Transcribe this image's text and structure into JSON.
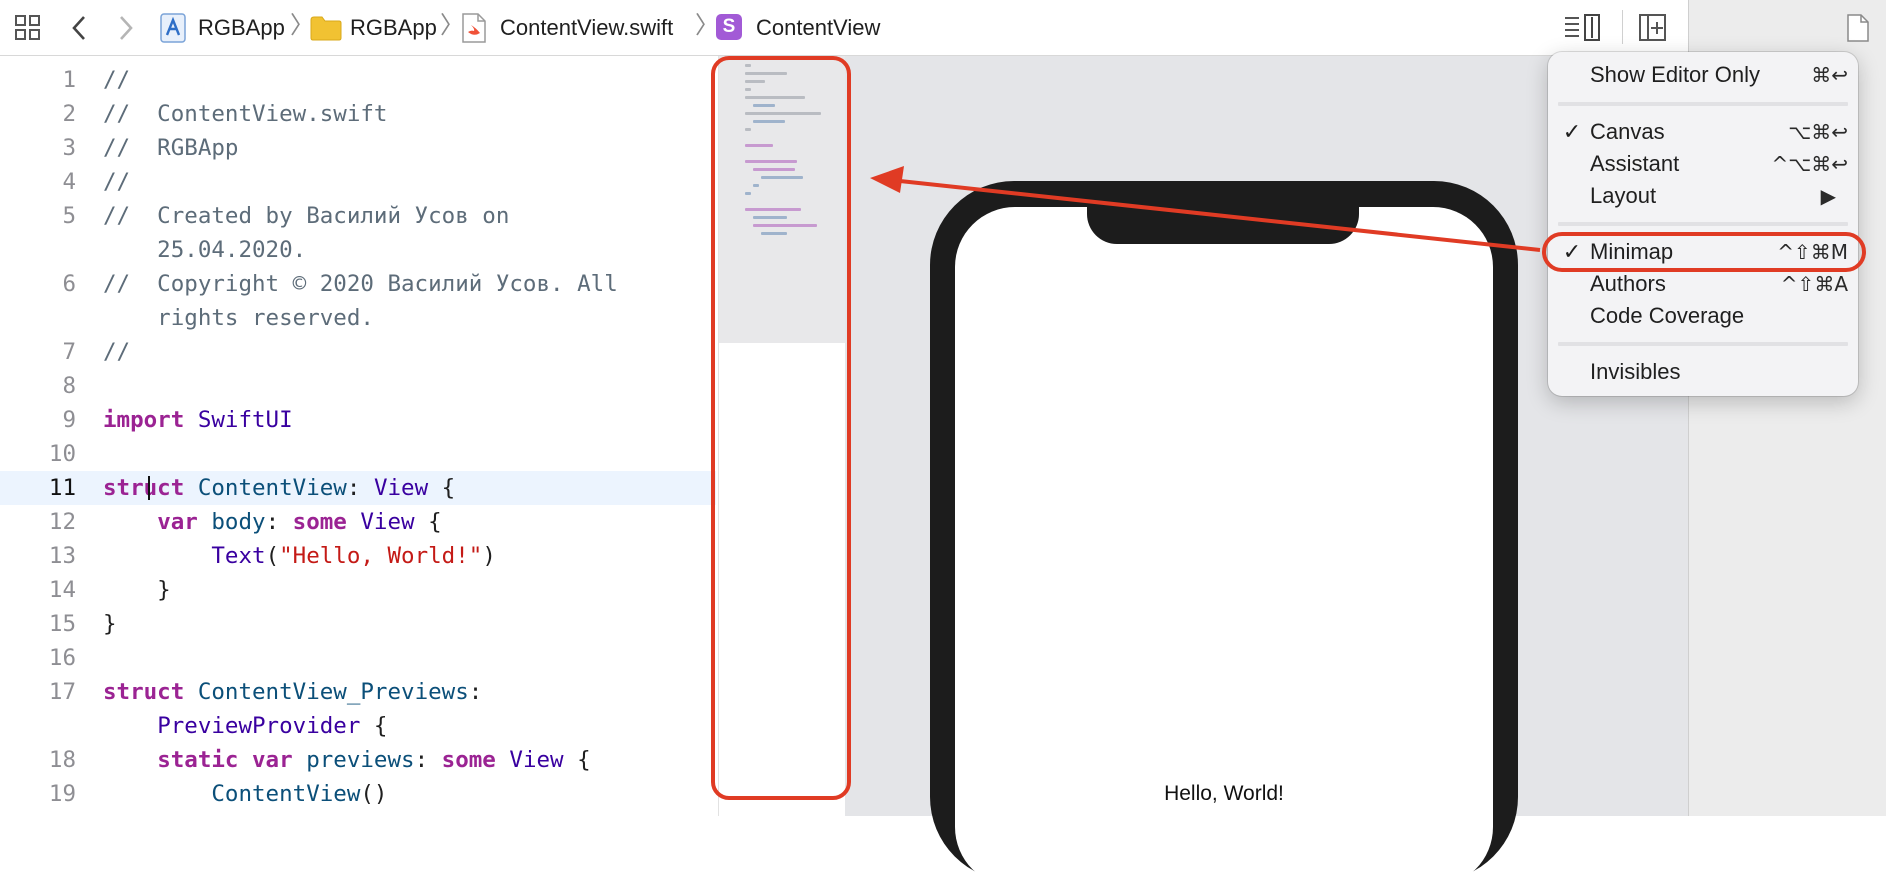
{
  "toolbar": {
    "breadcrumbs": [
      {
        "label": "RGBApp",
        "icon": "app-project-icon"
      },
      {
        "label": "RGBApp",
        "icon": "folder-icon"
      },
      {
        "label": "ContentView.swift",
        "icon": "swift-file-icon"
      },
      {
        "label": "ContentView",
        "icon": "struct-icon",
        "badge": "S"
      }
    ]
  },
  "editor": {
    "current_line": 11,
    "lines": [
      {
        "n": "1",
        "text": "//"
      },
      {
        "n": "2",
        "text": "//  ContentView.swift"
      },
      {
        "n": "3",
        "text": "//  RGBApp"
      },
      {
        "n": "4",
        "text": "//"
      },
      {
        "n": "5",
        "text": "//  Created by Василий Усов on"
      },
      {
        "n": "",
        "text": "    25.04.2020."
      },
      {
        "n": "6",
        "text": "//  Copyright © 2020 Василий Усов. All"
      },
      {
        "n": "",
        "text": "    rights reserved."
      },
      {
        "n": "7",
        "text": "//"
      },
      {
        "n": "8",
        "text": ""
      },
      {
        "n": "9",
        "text": "import SwiftUI"
      },
      {
        "n": "10",
        "text": ""
      },
      {
        "n": "11",
        "text": "struct ContentView: View {"
      },
      {
        "n": "12",
        "text": "    var body: some View {"
      },
      {
        "n": "13",
        "text": "        Text(\"Hello, World!\")"
      },
      {
        "n": "14",
        "text": "    }"
      },
      {
        "n": "15",
        "text": "}"
      },
      {
        "n": "16",
        "text": ""
      },
      {
        "n": "17",
        "text": "struct ContentView_Previews:"
      },
      {
        "n": "",
        "text": "    PreviewProvider {"
      },
      {
        "n": "18",
        "text": "    static var previews: some View {"
      },
      {
        "n": "19",
        "text": "        ContentView()"
      }
    ]
  },
  "preview": {
    "hello_text": "Hello, World!"
  },
  "menu": {
    "items": [
      {
        "label": "Show Editor Only",
        "shortcut": "⌘↩",
        "checked": false
      },
      {
        "label": "Canvas",
        "shortcut": "⌥⌘↩",
        "checked": true
      },
      {
        "label": "Assistant",
        "shortcut": "^⌥⌘↩",
        "checked": false
      },
      {
        "label": "Layout",
        "shortcut": "▶",
        "checked": false
      },
      {
        "label": "Minimap",
        "shortcut": "^⇧⌘M",
        "checked": true
      },
      {
        "label": "Authors",
        "shortcut": "^⇧⌘A",
        "checked": false
      },
      {
        "label": "Code Coverage",
        "shortcut": "",
        "checked": false
      },
      {
        "label": "Invisibles",
        "shortcut": "",
        "checked": false
      }
    ],
    "check_mark": "✓"
  },
  "colors": {
    "annotation": "#e03b24",
    "keyword": "#9b2393",
    "type": "#0b4f79",
    "system_type": "#3900a0",
    "string": "#c41a16",
    "comment": "#5d6c79"
  }
}
